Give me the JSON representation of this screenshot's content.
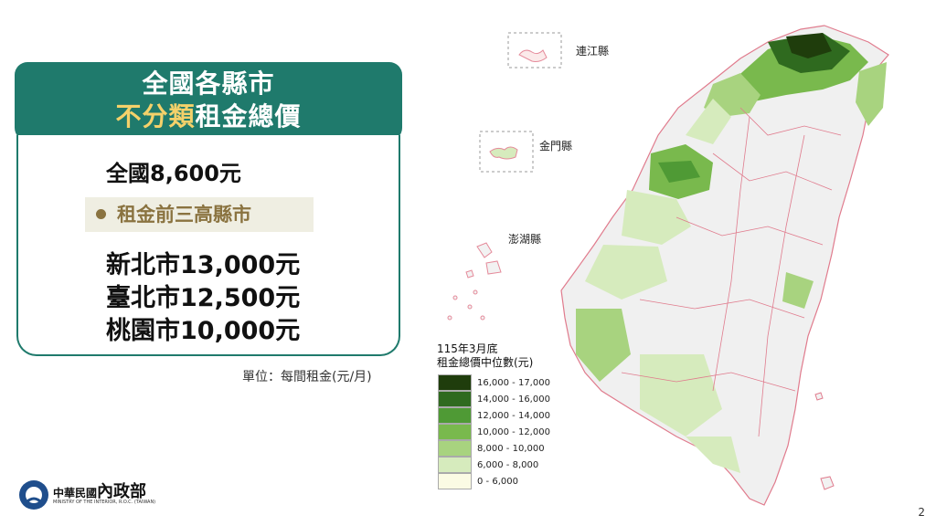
{
  "title": {
    "line1": "全國各縣市",
    "line2_highlight": "不分類",
    "line2_rest": "租金總價"
  },
  "national": "全國8,600元",
  "subhead": "租金前三高縣市",
  "top_cities": [
    "新北市13,000元",
    "臺北市12,500元",
    "桃園市10,000元"
  ],
  "unit_note": "單位：每間租金(元/月)",
  "legend": {
    "title_line1": "115年3月底",
    "title_line2": "租金總價中位數(元)",
    "items": [
      {
        "label": "16,000 - 17,000",
        "color": "#1f3d0c"
      },
      {
        "label": "14,000 - 16,000",
        "color": "#2f6a1f"
      },
      {
        "label": "12,000 - 14,000",
        "color": "#4f9a35"
      },
      {
        "label": "10,000 - 12,000",
        "color": "#79b94d"
      },
      {
        "label": "8,000 - 10,000",
        "color": "#a8d37f"
      },
      {
        "label": "6,000 - 8,000",
        "color": "#d6ebbd"
      },
      {
        "label": "0 - 6,000",
        "color": "#fbfbe4"
      }
    ]
  },
  "islands": {
    "lienchiang": "連江縣",
    "kinmen": "金門縣",
    "penghu": "澎湖縣"
  },
  "logo": {
    "name": "中華民國",
    "name2": "內政部",
    "sub": "MINISTRY OF THE INTERIOR, R.O.C. (TAIWAN)"
  },
  "page_number": "2"
}
